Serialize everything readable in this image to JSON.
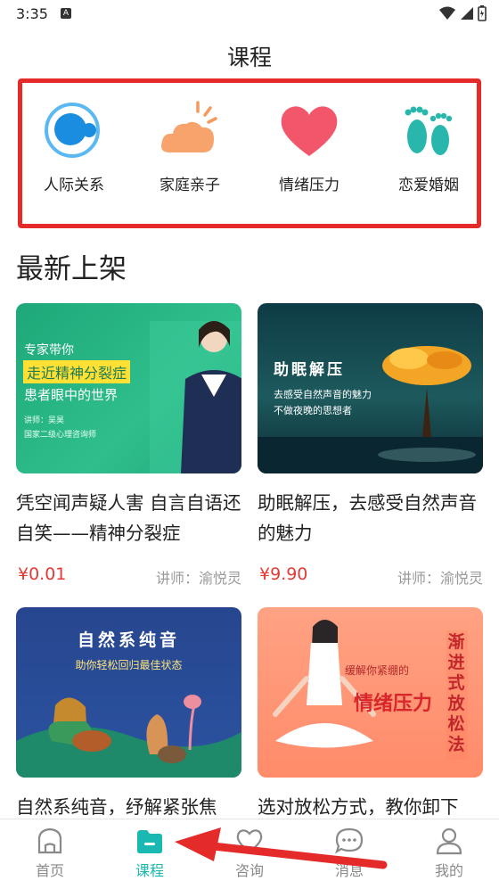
{
  "status": {
    "time": "3:35",
    "badge": "A"
  },
  "page": {
    "title": "课程"
  },
  "categories": [
    {
      "label": "人际关系",
      "icon": "people-circle-icon"
    },
    {
      "label": "家庭亲子",
      "icon": "cloud-sun-icon"
    },
    {
      "label": "情绪压力",
      "icon": "heart-icon"
    },
    {
      "label": "恋爱婚姻",
      "icon": "footprints-icon"
    }
  ],
  "section": {
    "title": "最新上架"
  },
  "courses": [
    {
      "title": "凭空闻声疑人害 自言自语还自笑——精神分裂症",
      "price": "¥0.01",
      "lecturer": "讲师：渝悦灵",
      "thumb": {
        "line1": "专家带你",
        "line2": "走近精神分裂症",
        "line3": "患者眼中的世界",
        "line4": "讲师：吴昊",
        "line5": "国家二级心理咨询师"
      }
    },
    {
      "title": "助眠解压，去感受自然声音的魅力",
      "price": "¥9.90",
      "lecturer": "讲师：渝悦灵",
      "thumb": {
        "line1": "助眠解压",
        "line2": "去感受自然声音的魅力",
        "line3": "不做夜晚的思想者"
      }
    },
    {
      "title": "自然系纯音，纾解紧张焦",
      "thumb": {
        "line1": "自然系纯音",
        "line2": "助你轻松回归最佳状态"
      }
    },
    {
      "title": "选对放松方式，教你卸下",
      "thumb": {
        "line1": "缓解你紧绷的",
        "line2": "情绪压力",
        "line3": "渐进式放松法"
      }
    }
  ],
  "tabs": [
    {
      "label": "首页",
      "icon": "home-icon"
    },
    {
      "label": "课程",
      "icon": "folder-icon",
      "active": true
    },
    {
      "label": "咨询",
      "icon": "heart-outline-icon"
    },
    {
      "label": "消息",
      "icon": "chat-bubble-icon"
    },
    {
      "label": "我的",
      "icon": "person-icon"
    }
  ],
  "colors": {
    "accent": "#19b8b1",
    "price": "#e53935",
    "highlight_border": "#e52a2a"
  }
}
